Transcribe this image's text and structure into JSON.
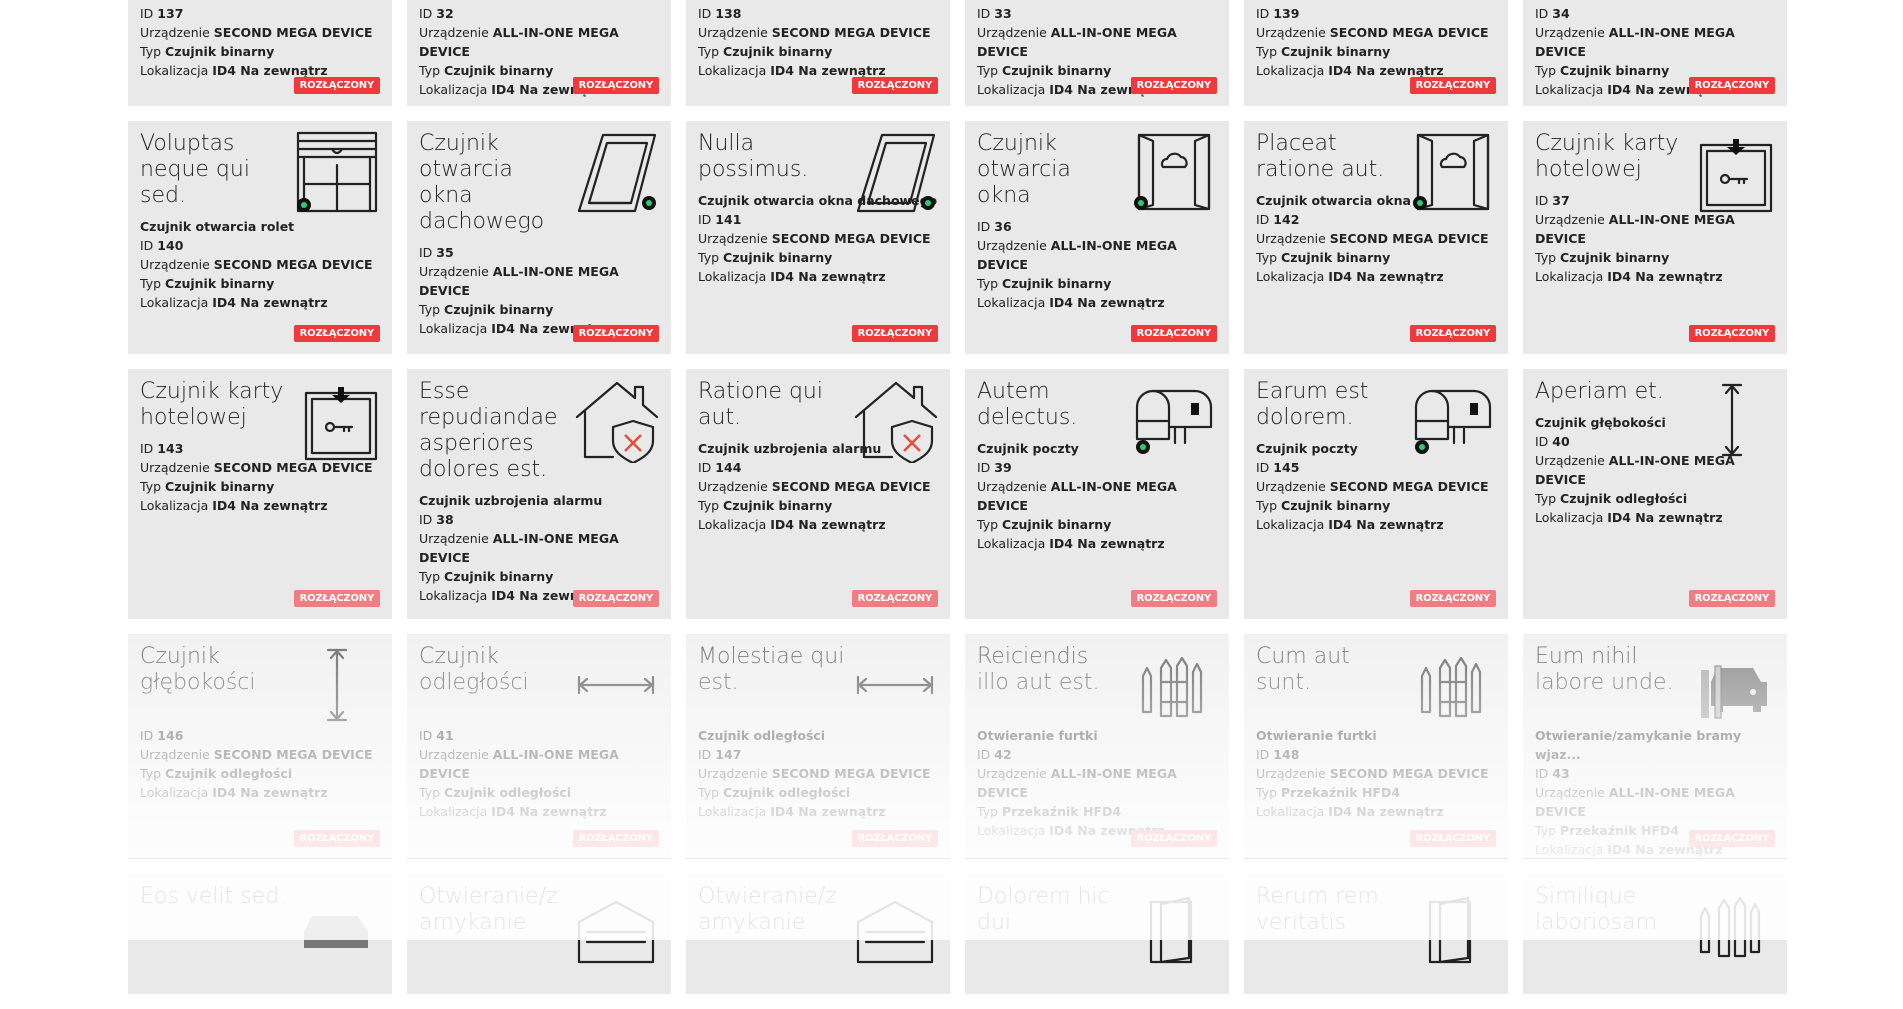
{
  "labels": {
    "id": "ID",
    "device": "Urządzenie",
    "type": "Typ",
    "location": "Lokalizacja",
    "status": "ROZŁĄCZONY"
  },
  "rows": [
    {
      "cards": [
        {
          "id": "137",
          "device": "SECOND MEGA DEVICE",
          "type": "Czujnik binarny",
          "location": "ID4 Na zewnątrz"
        },
        {
          "id": "32",
          "device": "ALL-IN-ONE MEGA DEVICE",
          "type": "Czujnik binarny",
          "location": "ID4 Na zewnątrz"
        },
        {
          "id": "138",
          "device": "SECOND MEGA DEVICE",
          "type": "Czujnik binarny",
          "location": "ID4 Na zewnątrz"
        },
        {
          "id": "33",
          "device": "ALL-IN-ONE MEGA DEVICE",
          "type": "Czujnik binarny",
          "location": "ID4 Na zewnątrz"
        },
        {
          "id": "139",
          "device": "SECOND MEGA DEVICE",
          "type": "Czujnik binarny",
          "location": "ID4 Na zewnątrz"
        },
        {
          "id": "34",
          "device": "ALL-IN-ONE MEGA DEVICE",
          "type": "Czujnik binarny",
          "location": "ID4 Na zewnątrz"
        }
      ]
    },
    {
      "cards": [
        {
          "title": "Voluptas neque qui sed.",
          "subtitle": "Czujnik otwarcia rolet",
          "id": "140",
          "device": "SECOND MEGA DEVICE",
          "type": "Czujnik binarny",
          "location": "ID4 Na zewnątrz",
          "icon": "roller-blind-icon"
        },
        {
          "title": "Czujnik otwarcia okna dachowego",
          "subtitle": "",
          "id": "35",
          "device": "ALL-IN-ONE MEGA DEVICE",
          "type": "Czujnik binarny",
          "location": "ID4 Na zewnątrz",
          "icon": "roof-window-icon"
        },
        {
          "title": "Nulla possimus.",
          "subtitle": "Czujnik otwarcia okna dachowego",
          "id": "141",
          "device": "SECOND MEGA DEVICE",
          "type": "Czujnik binarny",
          "location": "ID4 Na zewnątrz",
          "icon": "roof-window-icon"
        },
        {
          "title": "Czujnik otwarcia okna",
          "subtitle": "",
          "id": "36",
          "device": "ALL-IN-ONE MEGA DEVICE",
          "type": "Czujnik binarny",
          "location": "ID4 Na zewnątrz",
          "icon": "window-open-icon"
        },
        {
          "title": "Placeat ratione aut.",
          "subtitle": "Czujnik otwarcia okna",
          "id": "142",
          "device": "SECOND MEGA DEVICE",
          "type": "Czujnik binarny",
          "location": "ID4 Na zewnątrz",
          "icon": "window-open-icon"
        },
        {
          "title": "Czujnik karty hotelowej",
          "subtitle": "",
          "id": "37",
          "device": "ALL-IN-ONE MEGA DEVICE",
          "type": "Czujnik binarny",
          "location": "ID4 Na zewnątrz",
          "icon": "hotel-card-icon"
        }
      ]
    },
    {
      "cards": [
        {
          "title": "Czujnik karty hotelowej",
          "subtitle": "",
          "id": "143",
          "device": "SECOND MEGA DEVICE",
          "type": "Czujnik binarny",
          "location": "ID4 Na zewnątrz",
          "icon": "hotel-card-icon"
        },
        {
          "title": "Esse repudiandae asperiores dolores est.",
          "subtitle": "Czujnik uzbrojenia alarmu",
          "id": "38",
          "device": "ALL-IN-ONE MEGA DEVICE",
          "type": "Czujnik binarny",
          "location": "ID4 Na zewnątrz",
          "icon": "alarm-house-icon"
        },
        {
          "title": "Ratione qui aut.",
          "subtitle": "Czujnik uzbrojenia alarmu",
          "id": "144",
          "device": "SECOND MEGA DEVICE",
          "type": "Czujnik binarny",
          "location": "ID4 Na zewnątrz",
          "icon": "alarm-house-icon"
        },
        {
          "title": "Autem delectus.",
          "subtitle": "Czujnik poczty",
          "id": "39",
          "device": "ALL-IN-ONE MEGA DEVICE",
          "type": "Czujnik binarny",
          "location": "ID4 Na zewnątrz",
          "icon": "mailbox-icon"
        },
        {
          "title": "Earum est dolorem.",
          "subtitle": "Czujnik poczty",
          "id": "145",
          "device": "SECOND MEGA DEVICE",
          "type": "Czujnik binarny",
          "location": "ID4 Na zewnątrz",
          "icon": "mailbox-icon"
        },
        {
          "title": "Aperiam et.",
          "subtitle": "Czujnik głębokości",
          "id": "40",
          "device": "ALL-IN-ONE MEGA DEVICE",
          "type": "Czujnik odległości",
          "location": "ID4 Na zewnątrz",
          "icon": "depth-arrow-icon"
        }
      ]
    },
    {
      "cards": [
        {
          "title": "Czujnik głębokości",
          "subtitle": "",
          "id": "146",
          "device": "SECOND MEGA DEVICE",
          "type": "Czujnik odległości",
          "location": "ID4 Na zewnątrz",
          "icon": "depth-arrow-icon"
        },
        {
          "title": "Czujnik odległości",
          "subtitle": "",
          "id": "41",
          "device": "ALL-IN-ONE MEGA DEVICE",
          "type": "Czujnik odległości",
          "location": "ID4 Na zewnątrz",
          "icon": "distance-arrow-icon"
        },
        {
          "title": "Molestiae qui est.",
          "subtitle": "Czujnik odległości",
          "id": "147",
          "device": "SECOND MEGA DEVICE",
          "type": "Czujnik odległości",
          "location": "ID4 Na zewnątrz",
          "icon": "distance-arrow-icon"
        },
        {
          "title": "Reiciendis illo aut est.",
          "subtitle": "Otwieranie furtki",
          "id": "42",
          "device": "ALL-IN-ONE MEGA DEVICE",
          "type": "Przekaźnik HFD4",
          "location": "ID4 Na zewnątrz",
          "icon": "fence-icon"
        },
        {
          "title": "Cum aut sunt.",
          "subtitle": "Otwieranie furtki",
          "id": "148",
          "device": "SECOND MEGA DEVICE",
          "type": "Przekaźnik HFD4",
          "location": "ID4 Na zewnątrz",
          "icon": "fence-icon"
        },
        {
          "title": "Eum nihil labore unde.",
          "subtitle": "Otwieranie/zamykanie bramy wjaz...",
          "id": "43",
          "device": "ALL-IN-ONE MEGA DEVICE",
          "type": "Przekaźnik HFD4",
          "location": "ID4 Na zewnątrz",
          "icon": "car-gate-icon"
        }
      ]
    },
    {
      "cards": [
        {
          "title": "Eos velit sed.",
          "icon": "car-icon"
        },
        {
          "title": "Otwieranie/z amykanie",
          "icon": "garage-icon"
        },
        {
          "title": "Otwieranie/z amykanie",
          "icon": "garage-icon"
        },
        {
          "title": "Dolorem hic dui",
          "icon": "door-icon"
        },
        {
          "title": "Rerum rem veritatis",
          "icon": "door-icon"
        },
        {
          "title": "Similique laboriosam",
          "icon": "fence-icon"
        }
      ]
    }
  ]
}
